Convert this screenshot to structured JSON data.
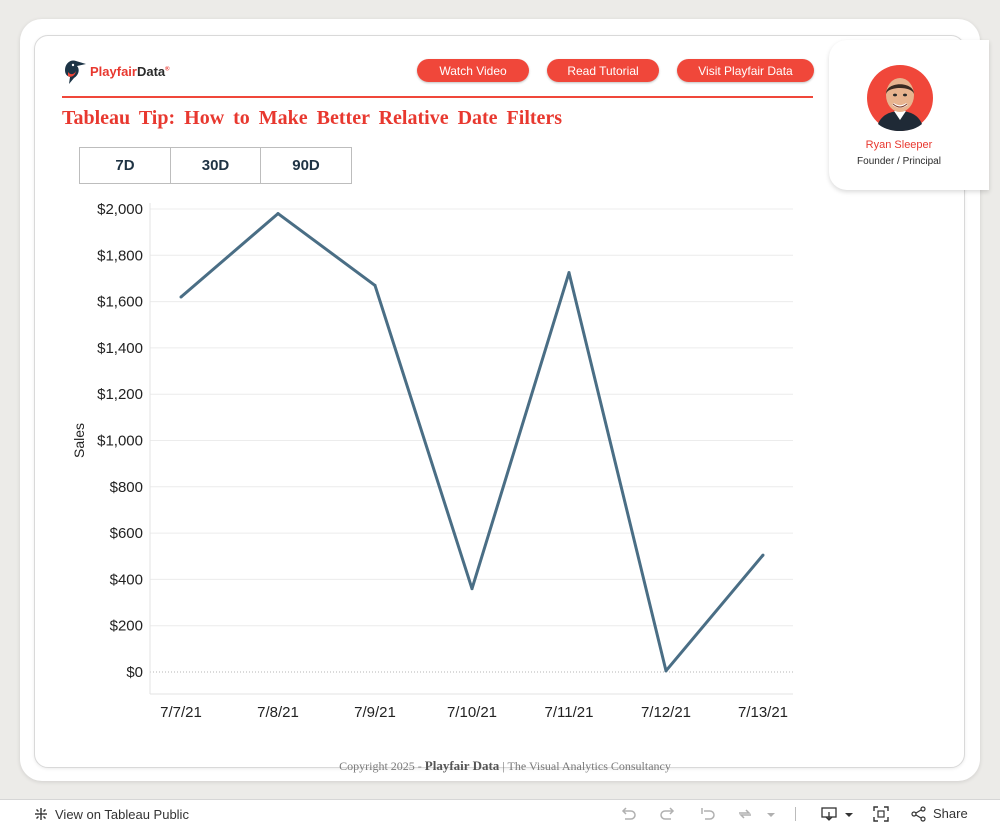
{
  "header": {
    "logo_word1": "Playfair",
    "logo_word2": "Data",
    "logo_reg": "®",
    "buttons": {
      "watch": "Watch Video",
      "tutorial": "Read Tutorial",
      "visit": "Visit Playfair Data"
    },
    "title": "Tableau Tip: How to Make Better Relative Date Filters"
  },
  "filters": {
    "d7": "7D",
    "d30": "30D",
    "d90": "90D"
  },
  "author": {
    "name": "Ryan Sleeper",
    "role": "Founder / Principal"
  },
  "chart_data": {
    "type": "line",
    "x": [
      "7/7/21",
      "7/8/21",
      "7/9/21",
      "7/10/21",
      "7/11/21",
      "7/12/21",
      "7/13/21"
    ],
    "series": [
      {
        "values": [
          1620,
          1980,
          1670,
          360,
          1725,
          5,
          505
        ]
      }
    ],
    "ylabel": "Sales",
    "yticks": [
      "$0",
      "$200",
      "$400",
      "$600",
      "$800",
      "$1,000",
      "$1,200",
      "$1,400",
      "$1,600",
      "$1,800",
      "$2,000"
    ],
    "ylim": [
      0,
      2000
    ],
    "grid": true,
    "line_color": "#4a6e85"
  },
  "footer": {
    "copyright": "Copyright 2025 -",
    "brand": "Playfair Data",
    "sep": "|",
    "tagline": "The Visual Analytics Consultancy"
  },
  "toolbar": {
    "view_label": "View on Tableau Public",
    "share_label": "Share"
  },
  "colors": {
    "accent": "#f0473a",
    "line": "#4a6e85"
  }
}
